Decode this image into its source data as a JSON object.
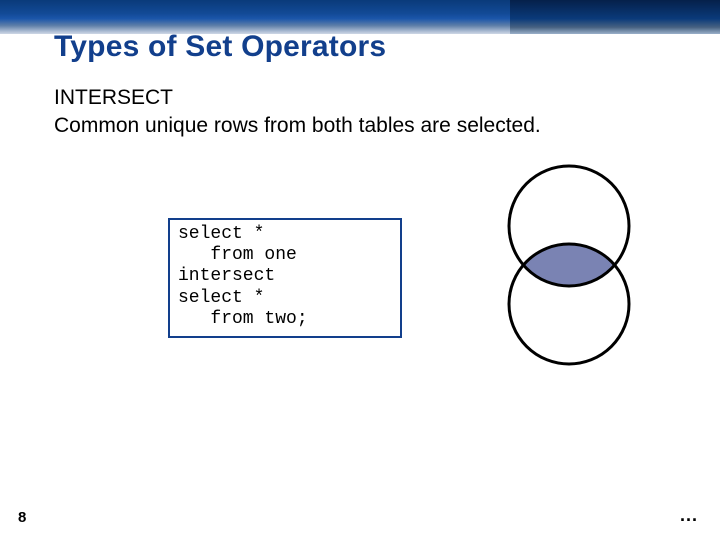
{
  "slide": {
    "title": "Types of Set Operators",
    "operator_name": "INTERSECT",
    "description": "Common unique rows from both tables are selected.",
    "code": "select *\n   from one\nintersect\nselect *\n   from two;",
    "page_number": "8",
    "ellipsis": "..."
  }
}
